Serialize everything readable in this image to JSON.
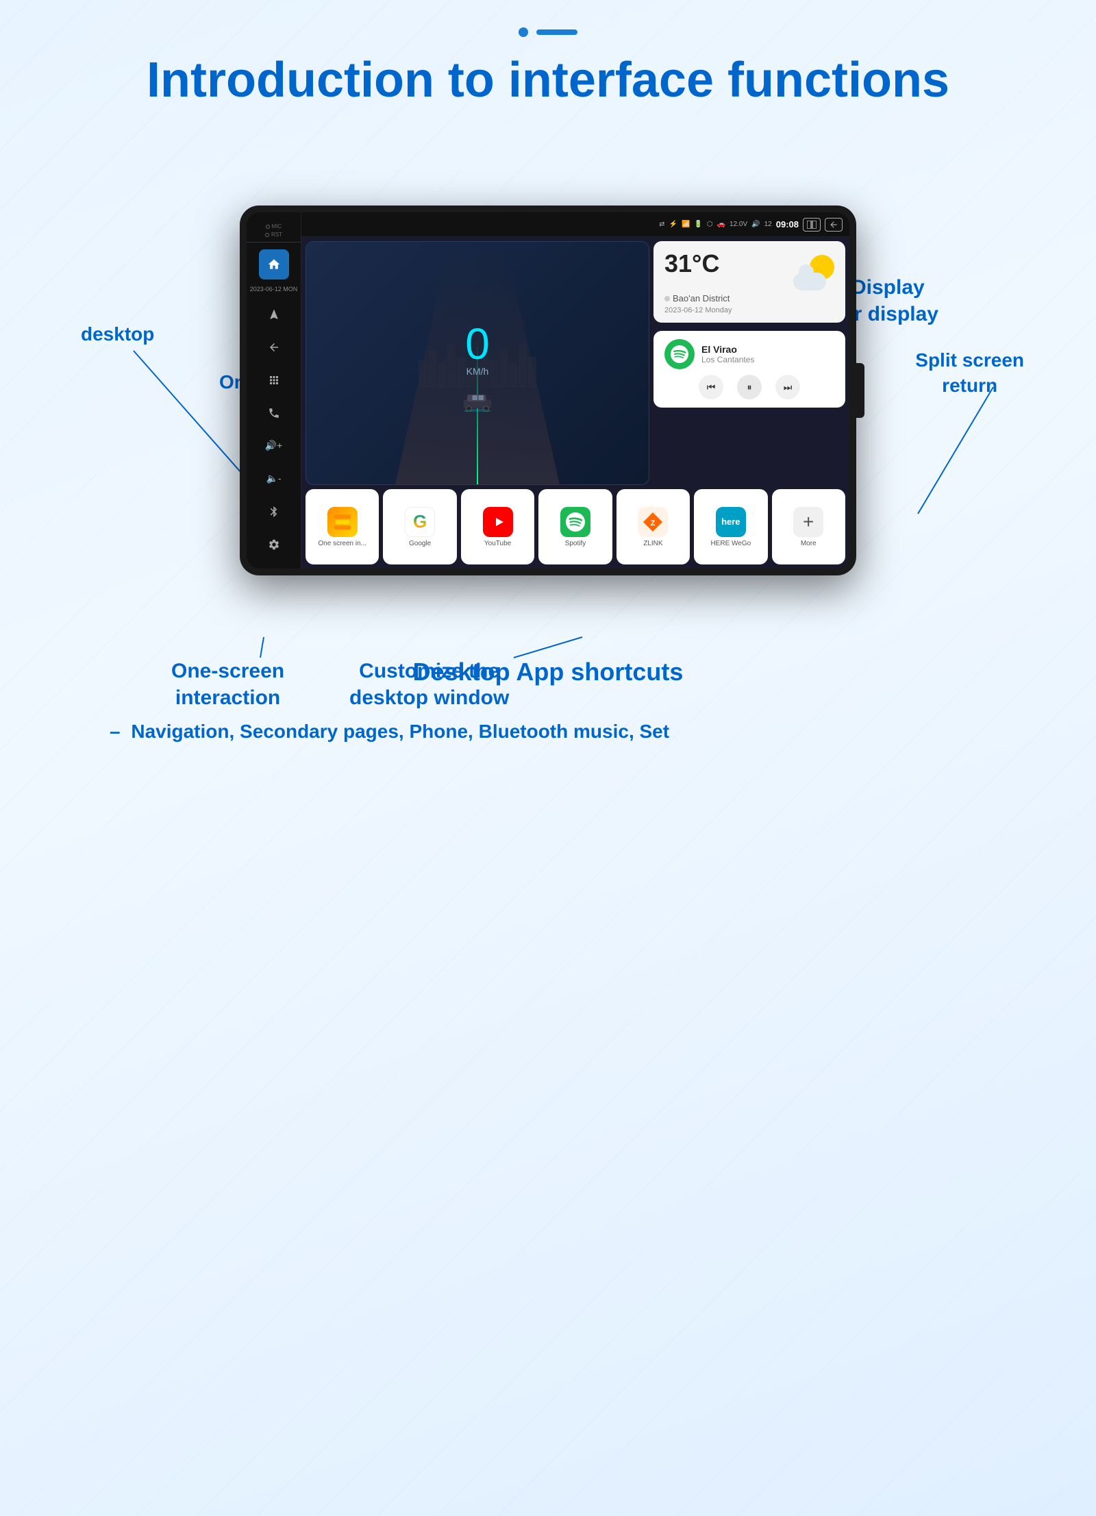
{
  "page": {
    "title": "Introduction to interface functions",
    "dots": {
      "circle": "•",
      "line": "—"
    }
  },
  "labels": {
    "desktop": "desktop",
    "one_screen_top": "One-screen interaction",
    "time_display": "Time Display\nweather display",
    "split_screen": "Split screen\nreturn",
    "one_screen_bottom": "One-screen\ninteraction",
    "customize": "Customize the\ndesktop window",
    "app_shortcuts": "Desktop App shortcuts",
    "navigation": "Navigation, Secondary pages, Phone, Bluetooth music, Set"
  },
  "device": {
    "sidebar": {
      "mic": "MIC",
      "rst": "RST",
      "date": "2023-06-12\nMON",
      "icons": [
        "home",
        "map",
        "back",
        "apps",
        "phone",
        "back2",
        "volume_up",
        "volume_down",
        "bluetooth",
        "settings"
      ]
    },
    "statusBar": {
      "icons": [
        "signal",
        "bluetooth",
        "wifi",
        "battery",
        "usb",
        "car",
        "voltage"
      ],
      "voltage": "12.0V",
      "volume": "12",
      "time": "09:08"
    },
    "speedWidget": {
      "speed": "0",
      "unit": "KM/h"
    },
    "weatherWidget": {
      "temp": "31°C",
      "location": "Bao'an District",
      "date": "2023-06-12 Monday"
    },
    "musicWidget": {
      "song": "El Virao",
      "artist": "Los Cantantes"
    },
    "apps": [
      {
        "id": "onescreen",
        "label": "One screen in..."
      },
      {
        "id": "google",
        "label": "Google"
      },
      {
        "id": "youtube",
        "label": "YouTube"
      },
      {
        "id": "spotify",
        "label": "Spotify"
      },
      {
        "id": "zlink",
        "label": "ZLINK"
      },
      {
        "id": "here",
        "label": "HERE WeGo"
      },
      {
        "id": "more",
        "label": "More"
      }
    ]
  }
}
